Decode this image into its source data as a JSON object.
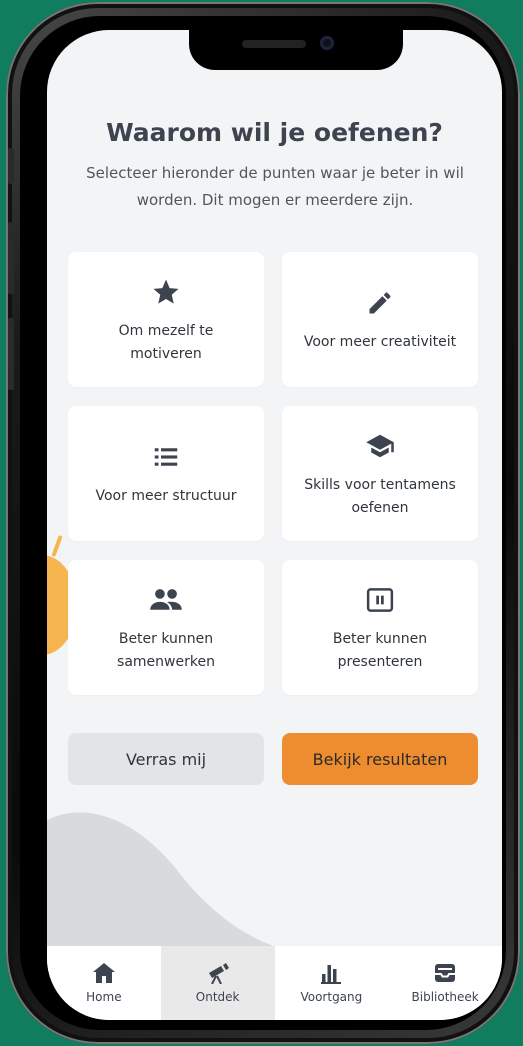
{
  "colors": {
    "background": "#0f7d5e",
    "screen_bg": "#f3f4f6",
    "accent": "#ee8d2f",
    "text_dark": "#3d4450",
    "icon": "#3d4450"
  },
  "header": {
    "title": "Waarom wil je oefenen?",
    "subtitle": "Selecteer hieronder de punten waar je beter in wil worden. Dit mogen er meerdere zijn."
  },
  "options": [
    {
      "label": "Om mezelf te motiveren",
      "icon": "star-icon"
    },
    {
      "label": "Voor meer creativiteit",
      "icon": "pencil-icon"
    },
    {
      "label": "Voor meer structuur",
      "icon": "list-icon"
    },
    {
      "label": "Skills voor tentamens oefenen",
      "icon": "graduation-cap-icon"
    },
    {
      "label": "Beter kunnen samenwerken",
      "icon": "people-icon"
    },
    {
      "label": "Beter kunnen presenteren",
      "icon": "presentation-icon"
    }
  ],
  "actions": {
    "surprise_label": "Verras mij",
    "results_label": "Bekijk resultaten"
  },
  "tabbar": {
    "items": [
      {
        "label": "Home",
        "icon": "home-icon",
        "active": false
      },
      {
        "label": "Ontdek",
        "icon": "telescope-icon",
        "active": true
      },
      {
        "label": "Voortgang",
        "icon": "bar-chart-icon",
        "active": false
      },
      {
        "label": "Bibliotheek",
        "icon": "inbox-icon",
        "active": false
      }
    ]
  }
}
